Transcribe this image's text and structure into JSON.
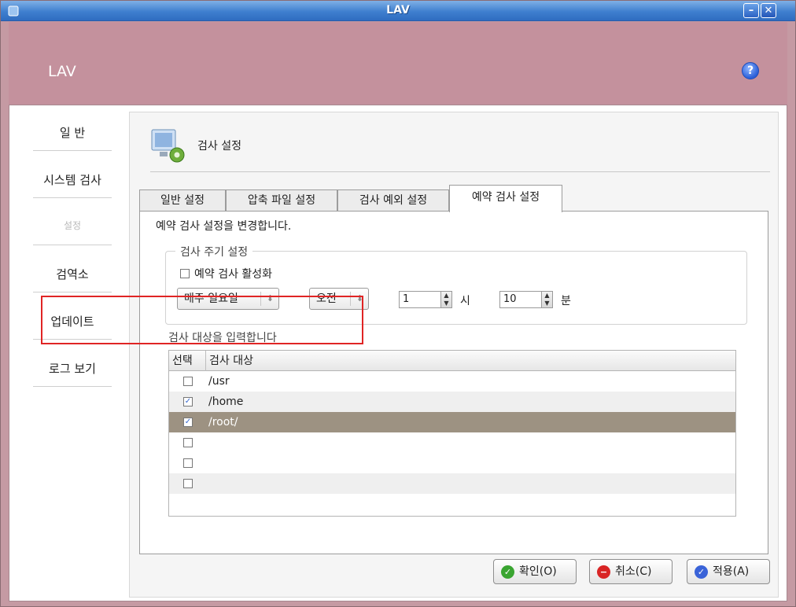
{
  "window": {
    "title": "LAV"
  },
  "header": {
    "brand": "LAV",
    "help_glyph": "?"
  },
  "sidebar": {
    "items": [
      {
        "label": "일 반"
      },
      {
        "label": "시스템 검사"
      },
      {
        "label": "설정"
      },
      {
        "label": "검역소"
      },
      {
        "label": "업데이트"
      },
      {
        "label": "로그 보기"
      }
    ]
  },
  "section": {
    "title": "검사 설정"
  },
  "tabs": [
    {
      "label": "일반 설정"
    },
    {
      "label": "압축 파일 설정"
    },
    {
      "label": "검사 예외 설정"
    },
    {
      "label": "예약 검사 설정"
    }
  ],
  "tab_page": {
    "description": "예약 검사 설정을 변경합니다.",
    "group_title": "검사 주기 설정",
    "enable_label": "예약 검사 활성화",
    "enable_checked": false,
    "day_value": "매주 일요일",
    "ampm_value": "오전",
    "hour_value": "1",
    "hour_unit": "시",
    "minute_value": "10",
    "minute_unit": "분",
    "targets_label": "검사 대상을 입력합니다",
    "list_columns": {
      "select": "선택",
      "target": "검사 대상"
    },
    "rows": [
      {
        "path": "/usr",
        "checked": false
      },
      {
        "path": "/home",
        "checked": true
      },
      {
        "path": "/root/",
        "checked": true
      },
      {
        "path": "",
        "checked": false
      },
      {
        "path": "",
        "checked": false
      },
      {
        "path": "",
        "checked": false
      }
    ]
  },
  "buttons": {
    "ok": "확인(O)",
    "cancel": "취소(C)",
    "apply": "적용(A)"
  },
  "colors": {
    "accent_header": "#c4919d",
    "selected_row": "#9d9282",
    "highlight_box": "#e02424"
  }
}
